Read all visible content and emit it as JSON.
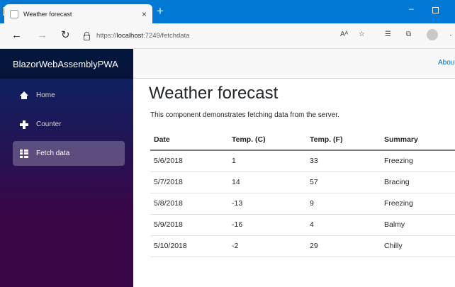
{
  "browser": {
    "tab_title": "Weather forecast",
    "tab_close": "×",
    "new_tab": "+",
    "url_prefix": "https://",
    "url_host": "localhost",
    "url_path": ":7249/fetchdata",
    "read_aloud": "Aᴬ",
    "minimize": "–"
  },
  "sidebar": {
    "brand": "BlazorWebAssemblyPWA",
    "items": [
      {
        "label": "Home",
        "icon": "home-icon"
      },
      {
        "label": "Counter",
        "icon": "plus-icon"
      },
      {
        "label": "Fetch data",
        "icon": "list-icon",
        "active": true
      }
    ]
  },
  "topbar": {
    "about": "About"
  },
  "main": {
    "title": "Weather forecast",
    "description": "This component demonstrates fetching data from the server."
  },
  "table": {
    "headers": [
      "Date",
      "Temp. (C)",
      "Temp. (F)",
      "Summary"
    ],
    "rows": [
      [
        "5/6/2018",
        "1",
        "33",
        "Freezing"
      ],
      [
        "5/7/2018",
        "14",
        "57",
        "Bracing"
      ],
      [
        "5/8/2018",
        "-13",
        "9",
        "Freezing"
      ],
      [
        "5/9/2018",
        "-16",
        "4",
        "Balmy"
      ],
      [
        "5/10/2018",
        "-2",
        "29",
        "Chilly"
      ]
    ]
  },
  "colors": {
    "titlebar": "#0078d4",
    "sidebar_top": "#052767",
    "sidebar_bottom": "#3a0647",
    "link": "#0071c1"
  }
}
